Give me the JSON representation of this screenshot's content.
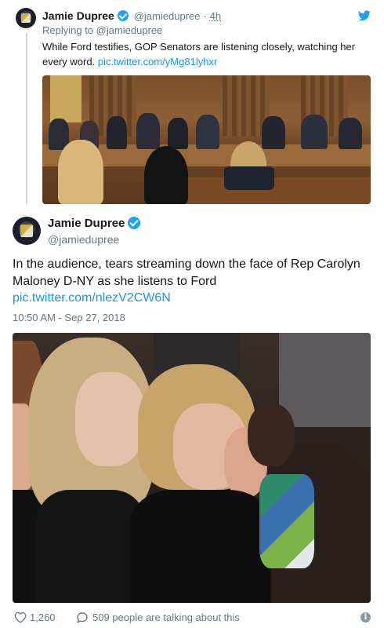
{
  "reply_tweet": {
    "author_name": "Jamie Dupree",
    "author_handle": "@jamiedupree",
    "separator": "·",
    "time": "4h",
    "replying_to": "Replying to @jamiedupree",
    "text": "While Ford testifies, GOP Senators are listening closely, watching her every word.",
    "link": "pic.twitter.com/yMg81lyhxr",
    "icon": "twitter-bird-icon"
  },
  "main_tweet": {
    "author_name": "Jamie Dupree",
    "author_handle": "@jamiedupree",
    "text": "In the audience, tears streaming down the face of Rep Carolyn Maloney D-NY as she listens to Ford",
    "link": "pic.twitter.com/nlezV2CW6N",
    "timestamp": "10:50 AM - Sep 27, 2018"
  },
  "footer": {
    "like_count": "1,260",
    "talking_text": "509 people are talking about this",
    "info_icon_glyph": "i"
  },
  "colors": {
    "accent": "#1da1f2",
    "link": "#1b95e0",
    "muted": "#657786",
    "text": "#14171a"
  }
}
